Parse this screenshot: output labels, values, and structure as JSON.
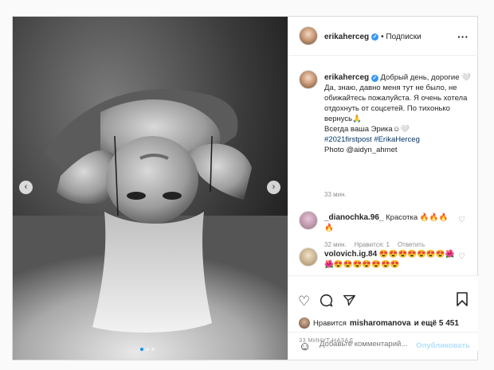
{
  "post": {
    "username": "erikaherceg",
    "follow_label": "• Подписки",
    "more_glyph": "···",
    "verified_glyph": "✓"
  },
  "caption": {
    "username": "erikaherceg",
    "line1": "Добрый день, дорогие",
    "line1_emoji": "🤍",
    "line2": "Да, знаю, давно меня тут не было, не обижайтесь пожалуйста. Я очень хотела отдохнуть от соцсетей. По тихонько вернусь",
    "line2_emoji": "🙏",
    "line3": "Всегда ваша Эрика",
    "line3_emoji": "☺🤍",
    "hashtags": "#2021firstpost #ErikaHerceg",
    "photo_credit": "Photo @aidyn_ahmet",
    "time": "33 мин."
  },
  "comments": [
    {
      "username": "_dianochka.96_",
      "text": "Красотка 🔥🔥🔥🔥",
      "time": "32 мин.",
      "likes": "Нравится: 1",
      "reply": "Ответить"
    },
    {
      "username": "volovich.ig.84",
      "text": "😍😍😍😍😍😍😍🌺🌺😍😍😍😍😍😍😍"
    }
  ],
  "actions": {
    "liked_by_prefix": "Нравится",
    "liked_by_user": "misharomanova",
    "liked_by_suffix": "и ещё 5 451",
    "posted": "33 МИНУТ НАЗАД"
  },
  "comment_box": {
    "placeholder": "Добавьте комментарий...",
    "publish_label": "Опубликовать"
  },
  "carousel": {
    "prev_glyph": "‹",
    "next_glyph": "›",
    "slide_count": 3,
    "active_slide": 1
  },
  "colors": {
    "accent": "#0095f6",
    "verified": "#3897f0",
    "link": "#00376b",
    "muted": "#8e8e8e",
    "border": "#dbdbdb"
  }
}
